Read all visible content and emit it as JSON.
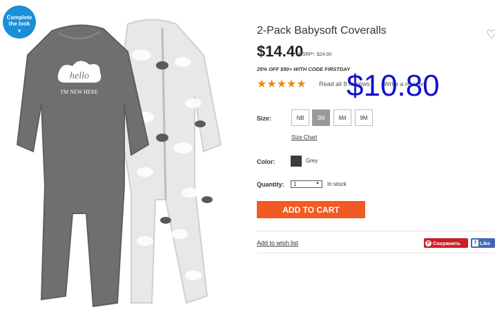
{
  "badge": {
    "line1": "Complete",
    "line2": "the look",
    "arrow": "▾"
  },
  "product": {
    "title": "2-Pack Babysoft Coveralls",
    "price": "$14.40",
    "msrp": "MSRP*: $24.00",
    "promo": "25% OFF $50+ WITH CODE FIRSTDAY",
    "stars": "★★★★★",
    "rating": 5,
    "reviews_link": "Read all 8 reviews",
    "write_review": "Write a review",
    "overlay_price": "$10.80",
    "garment_text_1": "hello",
    "garment_text_2": "I'M NEW HERE"
  },
  "size": {
    "label": "Size:",
    "options": [
      "NB",
      "3M",
      "6M",
      "9M"
    ],
    "selected": "3M",
    "chart_link": "Size Chart"
  },
  "color": {
    "label": "Color:",
    "value": "Grey"
  },
  "quantity": {
    "label": "Quantity:",
    "value": "1",
    "stock": "In stock"
  },
  "actions": {
    "add_to_cart": "ADD TO CART",
    "wishlist": "Add to wish list",
    "pinterest": "Сохранить",
    "facebook": "Like"
  },
  "icons": {
    "heart": "heart-icon",
    "pinterest": "pinterest-icon",
    "facebook": "facebook-icon"
  },
  "colors": {
    "accent_orange": "#f15a22",
    "star": "#f08a00",
    "overlay_blue": "#1010d0",
    "badge_blue": "#1a8fd8"
  }
}
